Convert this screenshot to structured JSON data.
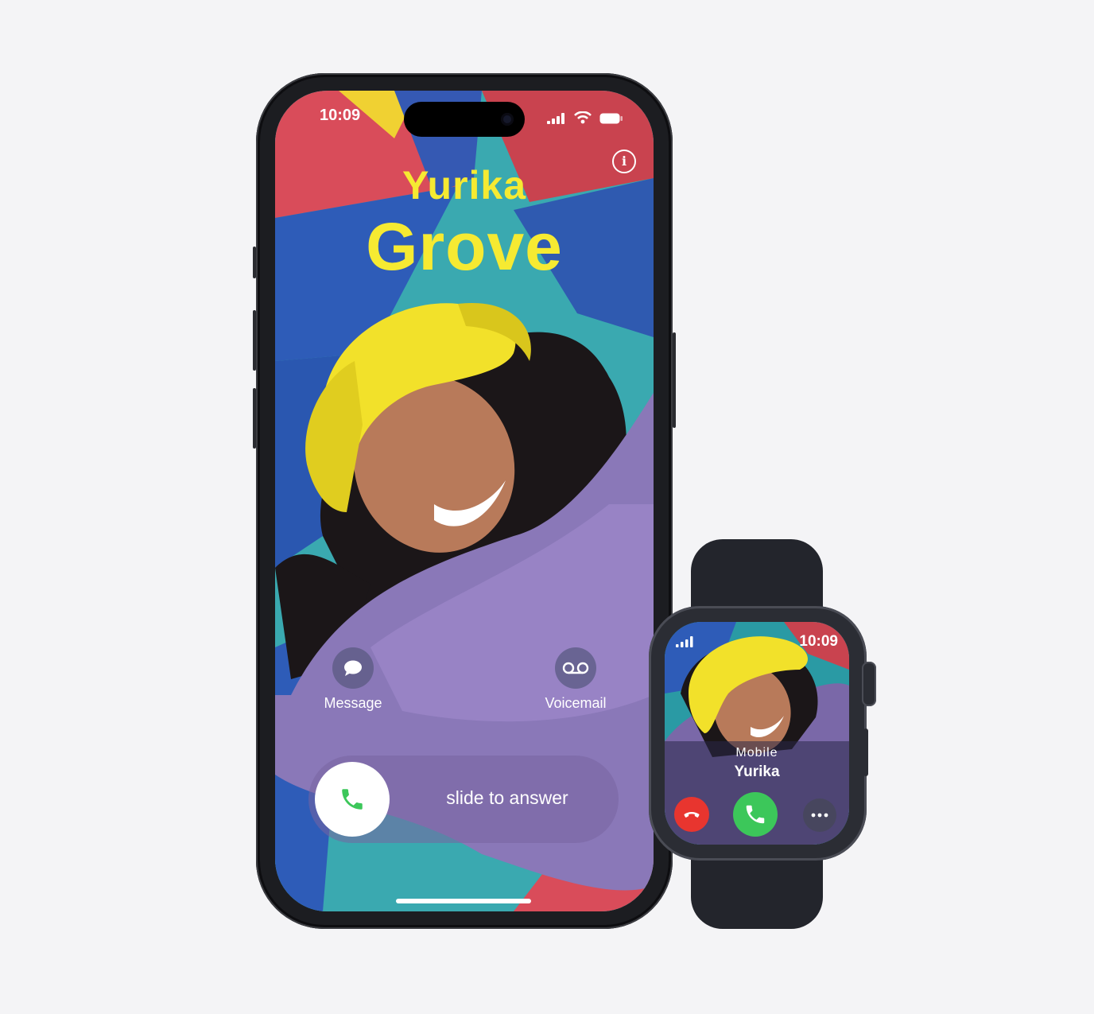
{
  "phone": {
    "status_time": "10:09",
    "contact_first_name": "Yurika",
    "contact_last_name": "Grove",
    "info_icon": "info-icon",
    "actions": [
      {
        "label": "Message",
        "icon": "message-bubble-icon"
      },
      {
        "label": "Voicemail",
        "icon": "voicemail-icon"
      }
    ],
    "slider_label": "slide to answer",
    "colors": {
      "name": "#f6ea32",
      "accept": "#3cc75a"
    }
  },
  "watch": {
    "status_time": "10:09",
    "label_type": "Mobile",
    "contact_name": "Yurika",
    "buttons": [
      {
        "icon": "decline-phone-icon",
        "color": "#e8352f"
      },
      {
        "icon": "accept-phone-icon",
        "color": "#3cc75a"
      },
      {
        "icon": "more-icon"
      }
    ]
  }
}
